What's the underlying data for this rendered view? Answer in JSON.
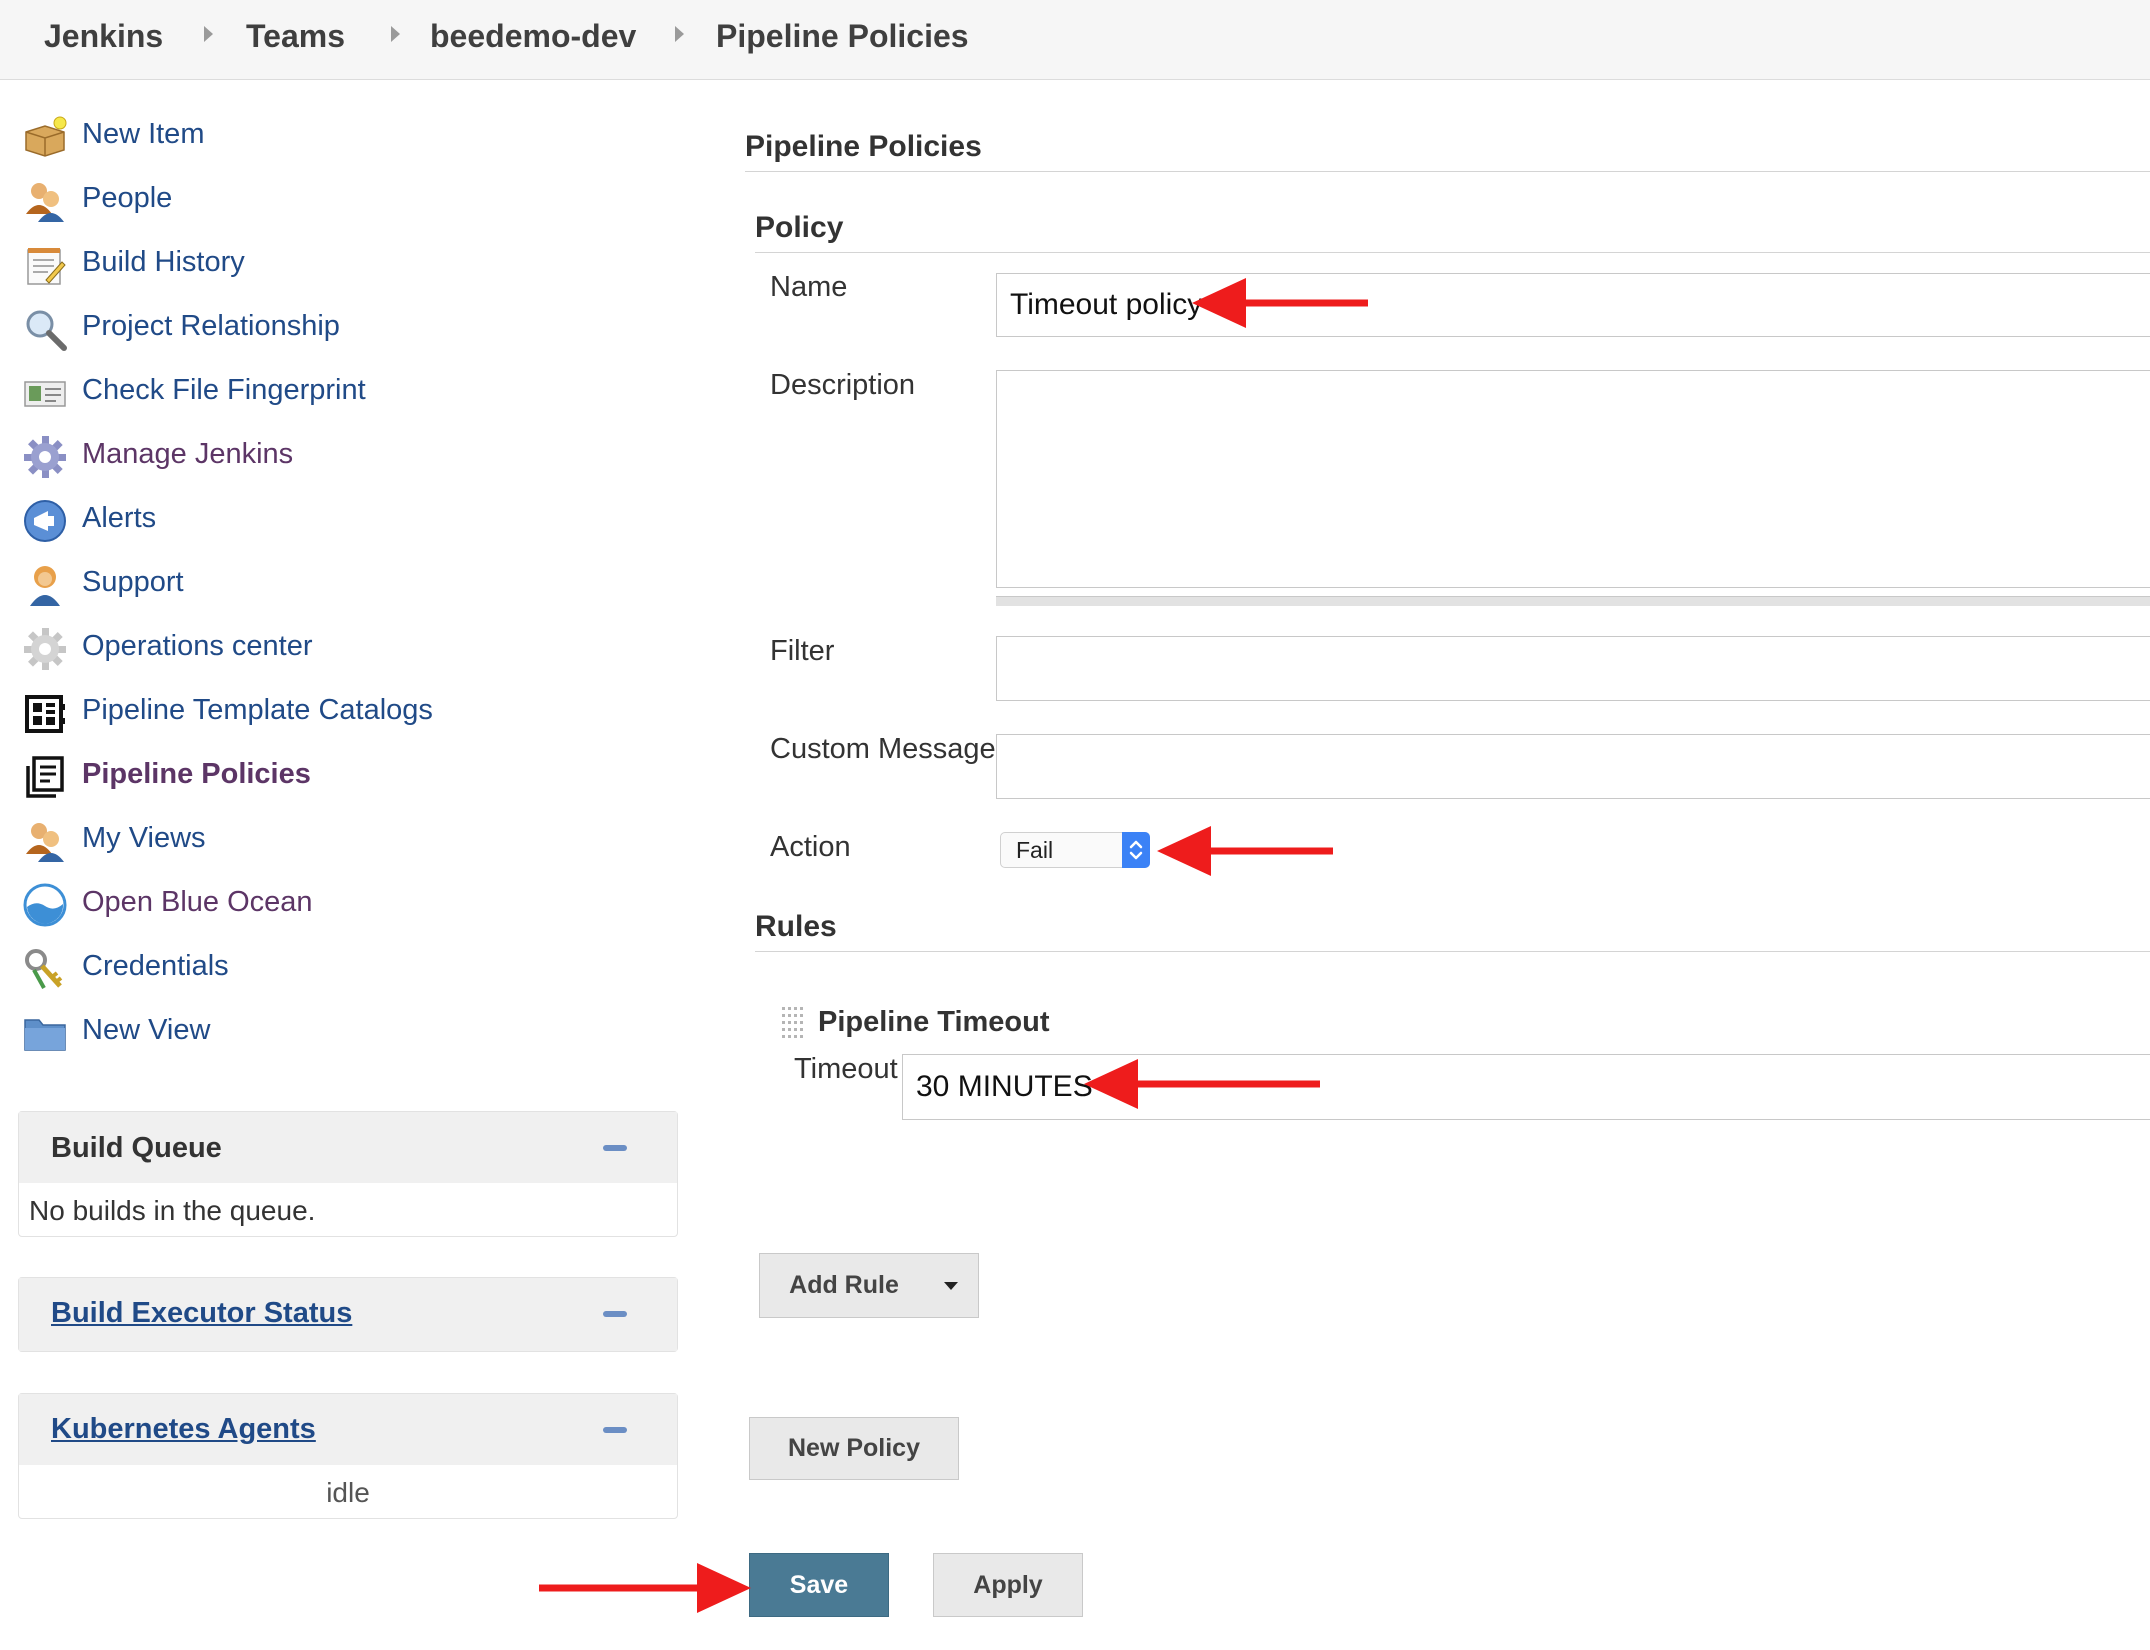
{
  "breadcrumb": [
    "Jenkins",
    "Teams",
    "beedemo-dev",
    "Pipeline Policies"
  ],
  "sidebar": {
    "tasks": [
      {
        "label": "New Item",
        "icon": "new-item-box-icon"
      },
      {
        "label": "People",
        "icon": "people-icon"
      },
      {
        "label": "Build History",
        "icon": "notepad-icon"
      },
      {
        "label": "Project Relationship",
        "icon": "magnifier-icon"
      },
      {
        "label": "Check File Fingerprint",
        "icon": "fingerprint-card-icon"
      },
      {
        "label": "Manage Jenkins",
        "icon": "gear-icon"
      },
      {
        "label": "Alerts",
        "icon": "megaphone-icon"
      },
      {
        "label": "Support",
        "icon": "support-agent-icon"
      },
      {
        "label": "Operations center",
        "icon": "gear-grey-icon"
      },
      {
        "label": "Pipeline Template Catalogs",
        "icon": "template-catalog-icon"
      },
      {
        "label": "Pipeline Policies",
        "icon": "policy-document-icon"
      },
      {
        "label": "My Views",
        "icon": "people-icon"
      },
      {
        "label": "Open Blue Ocean",
        "icon": "blue-ocean-icon"
      },
      {
        "label": "Credentials",
        "icon": "keys-icon"
      },
      {
        "label": "New View",
        "icon": "folder-icon"
      }
    ]
  },
  "build_queue": {
    "title": "Build Queue",
    "empty": "No builds in the queue."
  },
  "executor_status": {
    "title": "Build Executor Status"
  },
  "kubernetes_agents": {
    "title": "Kubernetes Agents",
    "status": "idle"
  },
  "form": {
    "page_title": "Pipeline Policies",
    "policy_section": "Policy",
    "name_label": "Name",
    "name_value": "Timeout policy",
    "description_label": "Description",
    "description_value": "",
    "filter_label": "Filter",
    "filter_value": "",
    "custom_message_label": "Custom Message",
    "custom_message_value": "",
    "action_label": "Action",
    "action_value": "Fail",
    "rules_section": "Rules",
    "rule_title": "Pipeline Timeout",
    "timeout_label": "Timeout",
    "timeout_value": "30 MINUTES",
    "add_rule_label": "Add Rule",
    "new_policy_label": "New Policy",
    "save_label": "Save",
    "apply_label": "Apply"
  },
  "colors": {
    "link": "#204a87",
    "visited_link": "#5c3566",
    "save_button": "#4a7a94",
    "annotation_arrow": "#ee1c1c"
  }
}
